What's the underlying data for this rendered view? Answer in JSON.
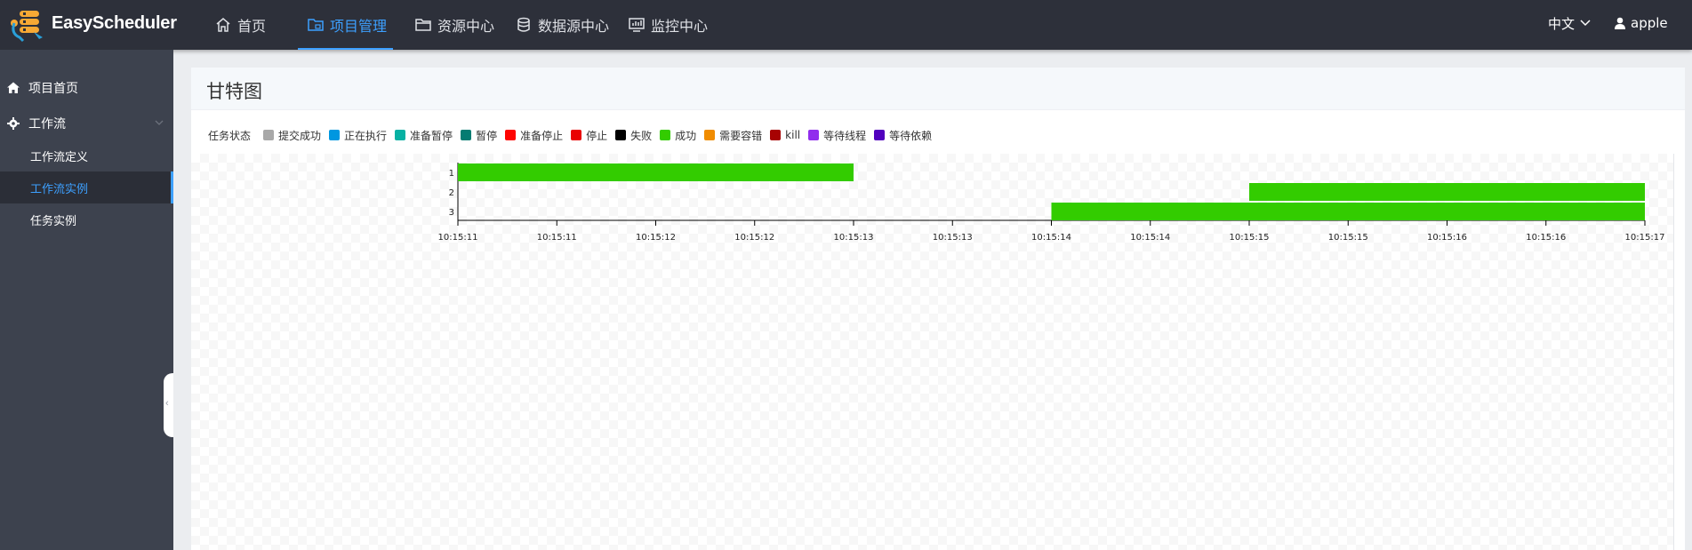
{
  "app": {
    "brand": "EasyScheduler"
  },
  "nav": {
    "items": [
      {
        "label": "首页",
        "icon": "home-icon",
        "active": false
      },
      {
        "label": "项目管理",
        "icon": "project-icon",
        "active": true
      },
      {
        "label": "资源中心",
        "icon": "folder-icon",
        "active": false
      },
      {
        "label": "数据源中心",
        "icon": "database-icon",
        "active": false
      },
      {
        "label": "监控中心",
        "icon": "monitor-icon",
        "active": false
      }
    ],
    "language": "中文",
    "user": "apple"
  },
  "sidebar": {
    "items": [
      {
        "label": "项目首页",
        "icon": "home-icon"
      },
      {
        "label": "工作流",
        "icon": "gear-icon",
        "expanded": true,
        "children": [
          {
            "label": "工作流定义",
            "active": false
          },
          {
            "label": "工作流实例",
            "active": true
          },
          {
            "label": "任务实例",
            "active": false
          }
        ]
      }
    ]
  },
  "page": {
    "title": "甘特图"
  },
  "legend": {
    "title": "任务状态",
    "items": [
      {
        "label": "提交成功",
        "color": "#a8a8a8"
      },
      {
        "label": "正在执行",
        "color": "#0097e0"
      },
      {
        "label": "准备暂停",
        "color": "#07b1a3"
      },
      {
        "label": "暂停",
        "color": "#057c72"
      },
      {
        "label": "准备停止",
        "color": "#fe0402"
      },
      {
        "label": "停止",
        "color": "#e90101"
      },
      {
        "label": "失败",
        "color": "#000000"
      },
      {
        "label": "成功",
        "color": "#33cc00"
      },
      {
        "label": "需要容错",
        "color": "#f08c00"
      },
      {
        "label": "kill",
        "color": "#a70202"
      },
      {
        "label": "等待线程",
        "color": "#912eed"
      },
      {
        "label": "等待依赖",
        "color": "#5101be"
      }
    ]
  },
  "chart_data": {
    "type": "bar",
    "subtype": "gantt",
    "title": "",
    "xlabel": "",
    "ylabel": "",
    "x_tick_labels": [
      "10:15:11",
      "10:15:11",
      "10:15:12",
      "10:15:12",
      "10:15:13",
      "10:15:13",
      "10:15:14",
      "10:15:14",
      "10:15:15",
      "10:15:15",
      "10:15:16",
      "10:15:16",
      "10:15:17"
    ],
    "xlim": [
      0,
      12
    ],
    "rows": [
      "1",
      "2",
      "3"
    ],
    "tasks": [
      {
        "row": "1",
        "start": 0,
        "end": 4,
        "status": "成功",
        "color": "#33cc00"
      },
      {
        "row": "2",
        "start": 8,
        "end": 12,
        "status": "成功",
        "color": "#33cc00"
      },
      {
        "row": "3",
        "start": 6,
        "end": 12,
        "status": "成功",
        "color": "#33cc00"
      }
    ],
    "grid": false,
    "legend_position": "top-left"
  }
}
